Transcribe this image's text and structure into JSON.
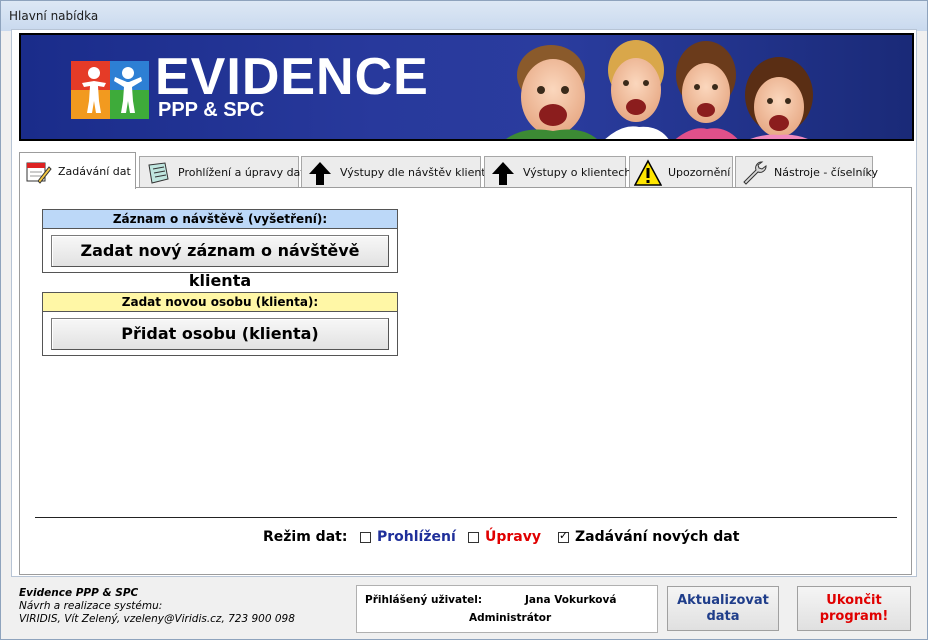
{
  "window": {
    "title": "Hlavní nabídka"
  },
  "banner": {
    "title": "EVIDENCE",
    "subtitle": "PPP & SPC",
    "colors": {
      "background": "#25379a",
      "red": "#e53b27",
      "blue": "#2d7fd4",
      "orange": "#f29a1f",
      "green": "#3eab3a"
    }
  },
  "tabs": [
    {
      "label": "Zadávání dat",
      "icon": "calendar-pencil-icon",
      "active": true
    },
    {
      "label": "Prohlížení a úpravy dat",
      "icon": "notebook-icon",
      "active": false
    },
    {
      "label": "Výstupy dle návštěv klientů",
      "icon": "up-arrow-icon",
      "active": false
    },
    {
      "label": "Výstupy o klientech",
      "icon": "up-arrow-icon",
      "active": false
    },
    {
      "label": "Upozornění",
      "icon": "warning-icon",
      "active": false
    },
    {
      "label": "Nástroje - číselníky",
      "icon": "wrench-icon",
      "active": false
    }
  ],
  "visit_group": {
    "header": "Záznam o návštěvě (vyšetření):",
    "button": "Zadat nový záznam o návštěvě klienta",
    "color": "#bcd8f8"
  },
  "person_group": {
    "header": "Zadat novou osobu (klienta):",
    "button": "Přidat osobu (klienta)",
    "color": "#fff7a6"
  },
  "data_mode": {
    "label": "Režim dat:",
    "options": [
      {
        "label": "Prohlížení",
        "checked": false,
        "color": "#1f2f9a"
      },
      {
        "label": "Úpravy",
        "checked": false,
        "color": "#e00000"
      },
      {
        "label": "Zadávání nových dat",
        "checked": true,
        "color": "#000000"
      }
    ]
  },
  "footer": {
    "app_name": "Evidence PPP & SPC",
    "line2": "Návrh a realizace systému:",
    "line3": "VIRIDIS, Vít Zelený, vzeleny@Viridis.cz, 723 900 098",
    "user_label": "Přihlášený uživatel:",
    "user_name": "Jana Vokurková",
    "user_role": "Administrátor",
    "refresh_button": "Aktualizovat data",
    "quit_button": "Ukončit program!"
  }
}
